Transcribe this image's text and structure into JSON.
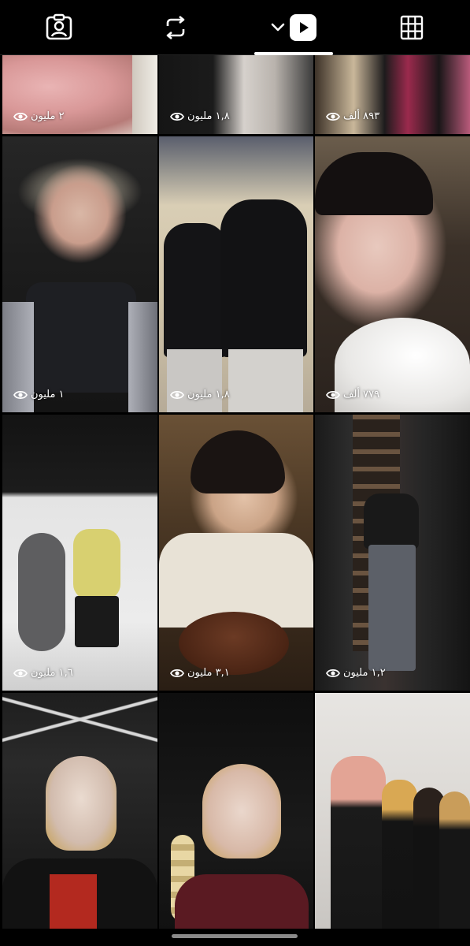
{
  "tabs": [
    {
      "name": "profile-tab",
      "icon": "person-square-icon"
    },
    {
      "name": "repost-tab",
      "icon": "repost-arrows-icon"
    },
    {
      "name": "videos-tab",
      "icon": "play-icon",
      "active": true
    },
    {
      "name": "grid-tab",
      "icon": "grid-icon"
    }
  ],
  "videos": [
    {
      "views": "٢ مليون"
    },
    {
      "views": "١,٨ مليون"
    },
    {
      "views": "٨٩٣ ألف"
    },
    {
      "views": "١ مليون"
    },
    {
      "views": "١,٨ مليون"
    },
    {
      "views": "٧٧٩ ألف"
    },
    {
      "views": "١,٦ مليون"
    },
    {
      "views": "٣,١ مليون"
    },
    {
      "views": "١,٢ مليون"
    },
    {
      "views": ""
    },
    {
      "views": ""
    },
    {
      "views": ""
    }
  ],
  "colors": {
    "background": "#000000",
    "text": "#ffffff",
    "indicator": "#ffffff"
  }
}
